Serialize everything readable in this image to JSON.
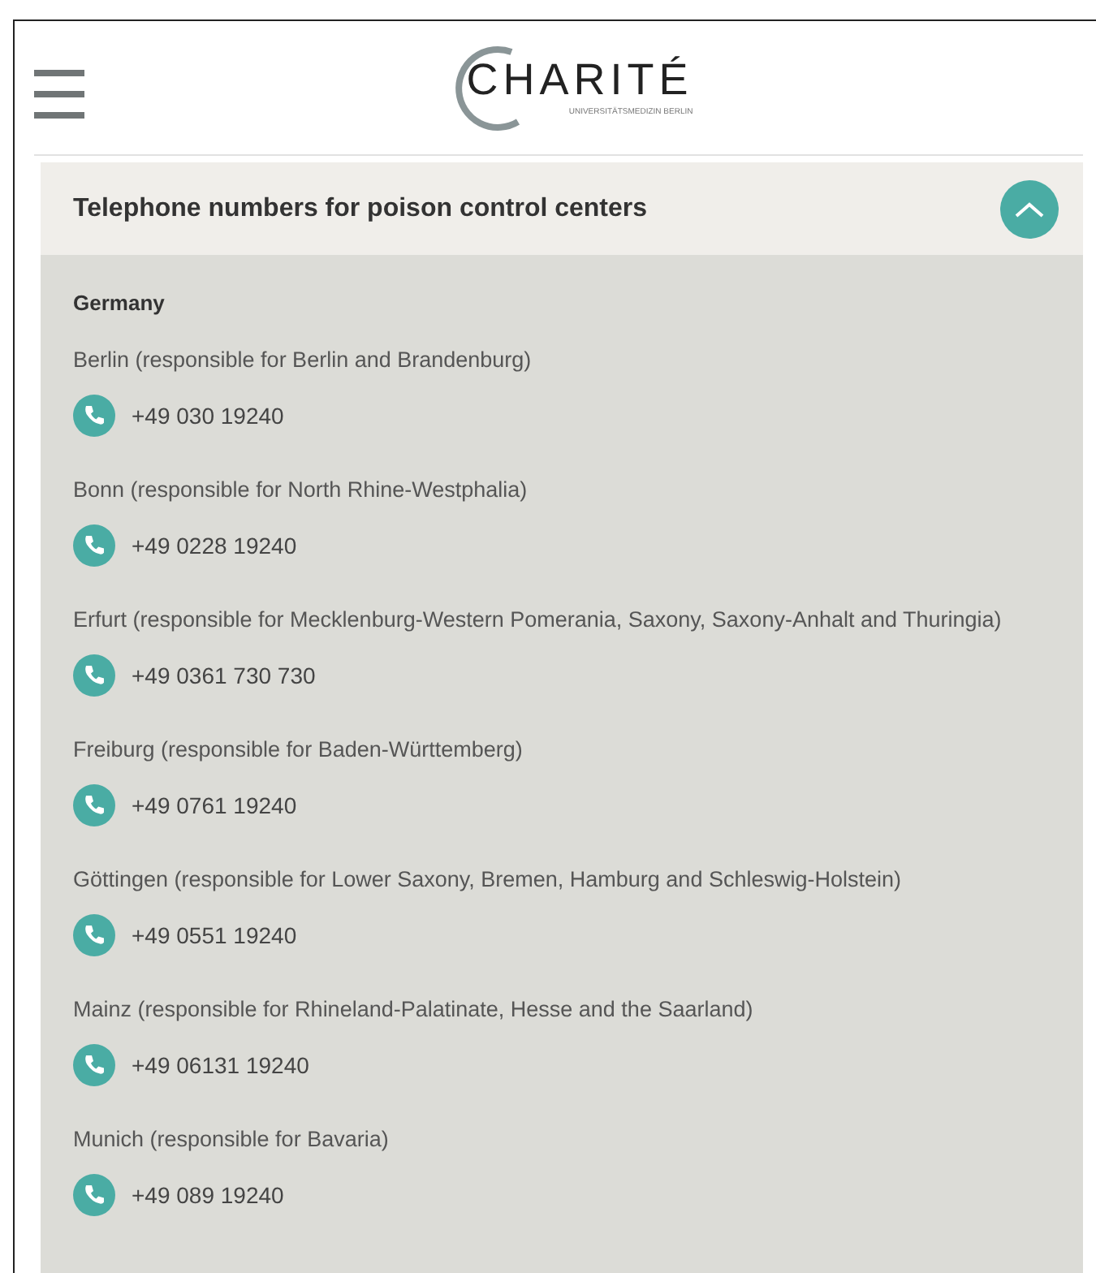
{
  "header": {
    "logo": {
      "name": "CHARITÉ",
      "subtitle": "UNIVERSITÄTSMEDIZIN BERLIN"
    }
  },
  "accordion": {
    "title": "Telephone numbers for poison control centers",
    "expanded": true,
    "section": "Germany",
    "centers": [
      {
        "label": "Berlin (responsible for Berlin and Brandenburg)",
        "phone": "+49 030 19240"
      },
      {
        "label": "Bonn (responsible for North Rhine-Westphalia)",
        "phone": "+49 0228 19240"
      },
      {
        "label": "Erfurt (responsible for Mecklenburg-Western Pomerania, Saxony, Saxony-Anhalt and Thuringia)",
        "phone": "+49 0361 730 730"
      },
      {
        "label": "Freiburg (responsible for Baden-Württemberg)",
        "phone": "+49 0761 19240"
      },
      {
        "label": "Göttingen (responsible for Lower Saxony, Bremen, Hamburg and Schleswig-Holstein)",
        "phone": "+49 0551 19240"
      },
      {
        "label": "Mainz (responsible for Rhineland-Palatinate, Hesse and the Saarland)",
        "phone": "+49 06131 19240"
      },
      {
        "label": "Munich (responsible for Bavaria)",
        "phone": "+49 089 19240"
      }
    ]
  }
}
